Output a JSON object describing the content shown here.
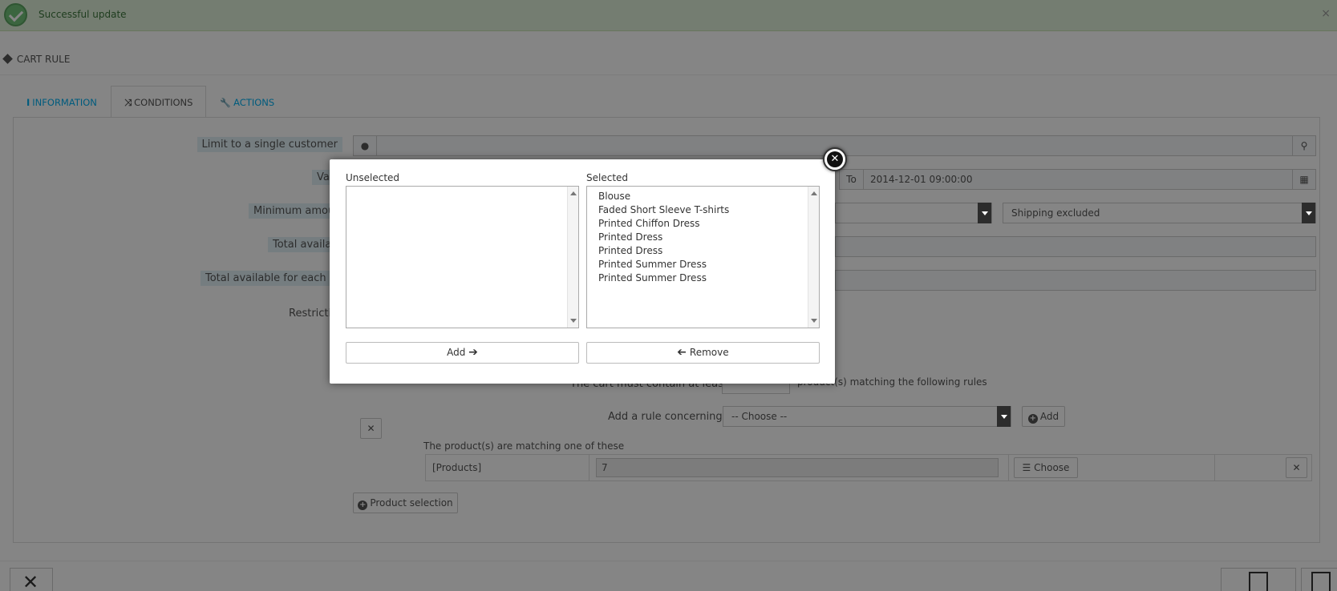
{
  "notification": {
    "text": "Successful update",
    "close": "×"
  },
  "panel": {
    "title": "CART RULE"
  },
  "tabs": [
    {
      "icon": "i",
      "label": "INFORMATION"
    },
    {
      "icon": "⤨",
      "label": "CONDITIONS"
    },
    {
      "icon": "🔧",
      "label": "ACTIONS"
    }
  ],
  "form": {
    "customer_label": "Limit to a single customer",
    "customer_value": "",
    "validity_label": "Va",
    "to_label": "To",
    "to_value": "2014-12-01 09:00:00",
    "min_amount_label": "Minimum amou",
    "shipping_select": "Shipping excluded",
    "total_available_label": "Total availab",
    "total_each_user_label": "Total available for each us",
    "restrictions_label": "Restrictio"
  },
  "rules": {
    "cart_contain_text": "The cart must contain at least",
    "matching_text": "product(s) matching the following rules",
    "add_rule_label": "Add a rule concerning",
    "choose_placeholder": "-- Choose --",
    "add_button": "Add",
    "group_text": "The product(s) are matching one of these",
    "row_type": "[Products]",
    "row_value": "7",
    "choose_button": "Choose",
    "product_selection_button": "Product selection"
  },
  "modal": {
    "unselected_title": "Unselected",
    "selected_title": "Selected",
    "unselected_items": [],
    "selected_items": [
      "Blouse",
      "Faded Short Sleeve T-shirts",
      "Printed Chiffon Dress",
      "Printed Dress",
      "Printed Dress",
      "Printed Summer Dress",
      "Printed Summer Dress"
    ],
    "add_button": "Add",
    "remove_button": "Remove"
  }
}
